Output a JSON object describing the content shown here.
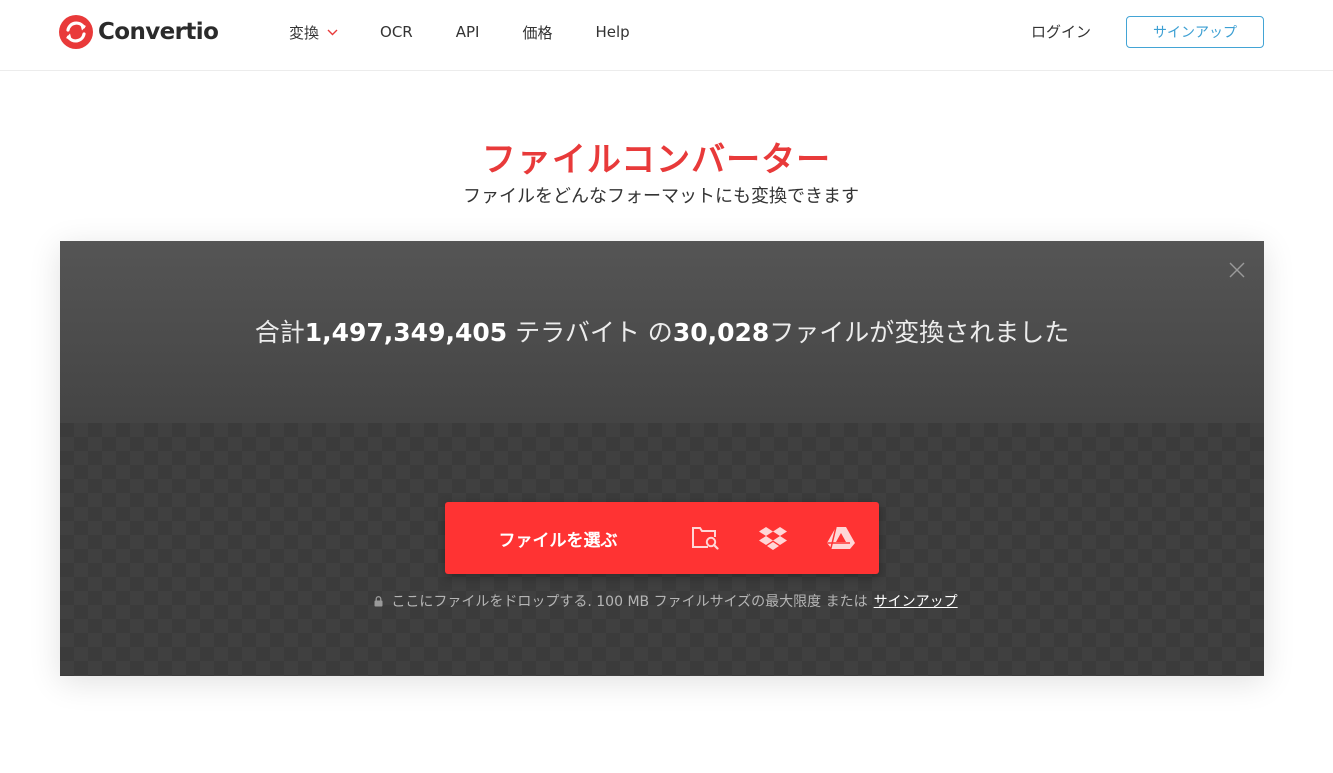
{
  "header": {
    "logo_text": "Convertio",
    "nav": [
      {
        "label": "変換",
        "has_dropdown": true
      },
      {
        "label": "OCR"
      },
      {
        "label": "API"
      },
      {
        "label": "価格"
      },
      {
        "label": "Help"
      }
    ],
    "login_label": "ログイン",
    "signup_label": "サインアップ"
  },
  "hero": {
    "title": "ファイルコンバーター",
    "subtitle": "ファイルをどんなフォーマットにも変換できます"
  },
  "stats": {
    "prefix": "合計",
    "terabytes": "1,497,349,405",
    "mid": " テラバイト の",
    "files": "30,028",
    "suffix": "ファイルが変換されました"
  },
  "upload": {
    "choose_label": "ファイルを選ぶ",
    "sources": [
      "folder-search-icon",
      "dropbox-icon",
      "google-drive-icon"
    ],
    "drop_hint": "ここにファイルをドロップする. 100 MB ファイルサイズの最大限度 または",
    "signup_link": "サインアップ"
  },
  "colors": {
    "brand_red": "#ff3333",
    "title_red": "#e83a3a",
    "signup_blue": "#43a4d5"
  }
}
